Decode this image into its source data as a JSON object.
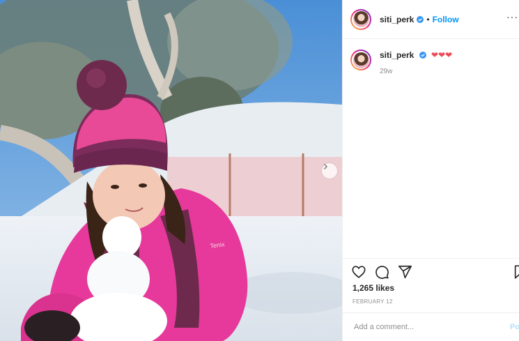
{
  "post": {
    "username": "siti_perk",
    "follow_label": "Follow",
    "dot": "•",
    "caption_hearts": "❤❤❤",
    "time_ago": "29w",
    "likes": "1,265 likes",
    "date": "FEBRUARY 12",
    "comment_placeholder": "Add a comment...",
    "post_label": "Po",
    "jacket_text": "Tenix"
  },
  "colors": {
    "accent": "#0095f6",
    "heart": "#ed4956",
    "verified": "#3897f0"
  },
  "icons": {
    "verified": "verified-badge-icon",
    "like": "heart-icon",
    "comment": "comment-icon",
    "share": "send-icon",
    "save": "bookmark-icon",
    "next": "chevron-right-icon"
  }
}
